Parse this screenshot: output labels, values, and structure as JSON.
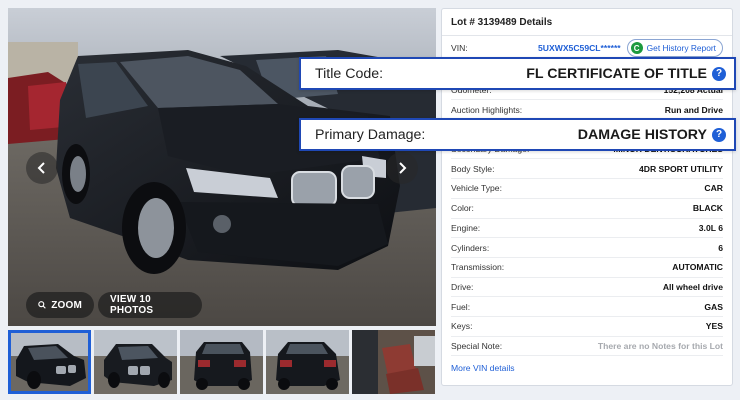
{
  "gallery": {
    "zoom_label": "ZOOM",
    "view_photos_label": "VIEW 10 PHOTOS"
  },
  "details": {
    "title": "Lot # 3139489 Details",
    "vin_label": "VIN:",
    "vin_value": "5UXWX5C59CL******",
    "history_report_label": "Get History Report",
    "rows": [
      {
        "label": "Odometer:",
        "value": "152,208 Actual"
      },
      {
        "label": "Auction Highlights:",
        "value": "Run and Drive"
      },
      {
        "label": "Secondary Damage:",
        "value": "MINOR DENT/SCRATCHES"
      },
      {
        "label": "Body Style:",
        "value": "4DR SPORT UTILITY"
      },
      {
        "label": "Vehicle Type:",
        "value": "CAR"
      },
      {
        "label": "Color:",
        "value": "BLACK"
      },
      {
        "label": "Engine:",
        "value": "3.0L 6"
      },
      {
        "label": "Cylinders:",
        "value": "6"
      },
      {
        "label": "Transmission:",
        "value": "AUTOMATIC"
      },
      {
        "label": "Drive:",
        "value": "All wheel drive"
      },
      {
        "label": "Fuel:",
        "value": "GAS"
      },
      {
        "label": "Keys:",
        "value": "YES"
      },
      {
        "label": "Special Note:",
        "value": "There are no Notes for this Lot"
      }
    ],
    "more_vin_label": "More VIN details"
  },
  "callouts": {
    "title_code": {
      "label": "Title Code:",
      "value": "FL CERTIFICATE OF TITLE"
    },
    "primary_damage": {
      "label": "Primary Damage:",
      "value": "DAMAGE HISTORY"
    }
  },
  "colors": {
    "accent": "#1f5fd6",
    "callout_border": "#1f48b5",
    "history_icon": "#1d9a3e"
  }
}
